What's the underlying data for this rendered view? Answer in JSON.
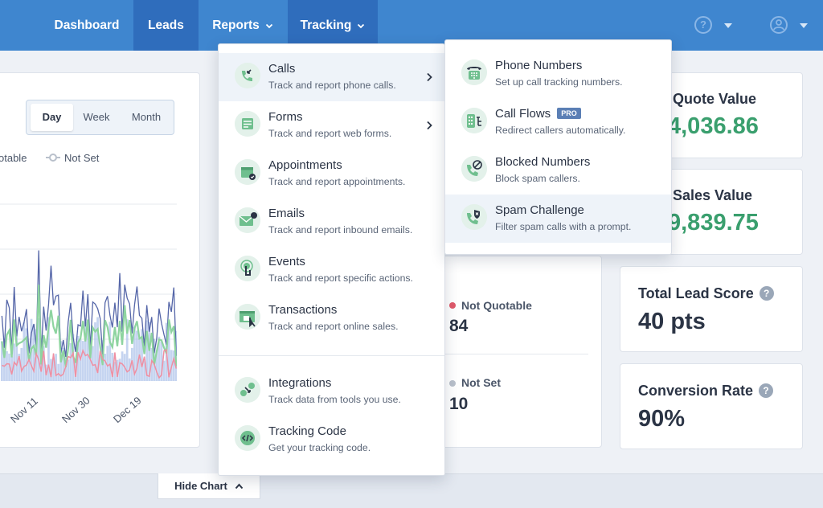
{
  "nav": {
    "items": [
      {
        "label": "Dashboard"
      },
      {
        "label": "Leads"
      },
      {
        "label": "Reports"
      },
      {
        "label": "Tracking"
      }
    ],
    "help_icon": "question-circle-icon",
    "user_icon": "user-circle-icon"
  },
  "chart_panel": {
    "period_buttons": [
      "Day",
      "Week",
      "Month"
    ],
    "legend": [
      "otable",
      "Not Set"
    ],
    "x_ticks": [
      "Nov 11",
      "Nov 30",
      "Dec 19"
    ],
    "series_colors": {
      "navy": "#5566a8",
      "green": "#8ed4a0",
      "pink": "#ef8fa2",
      "blue": "#9fb7e6"
    }
  },
  "stats": [
    {
      "label": "Not Quotable",
      "value": "84",
      "dot_color": "#e05a6b"
    },
    {
      "label": "Not Set",
      "value": "10",
      "dot_color": "#b9c0cb"
    }
  ],
  "metrics": [
    {
      "title": "Quote Value",
      "value": "4,036.86",
      "value_color": "#3a9f6e"
    },
    {
      "title": "Sales Value",
      "value": "9,839.75",
      "value_color": "#3a9f6e"
    },
    {
      "title": "Total Lead Score",
      "value": "40 pts",
      "value_color": "#2b3445"
    },
    {
      "title": "Conversion Rate",
      "value": "90%",
      "value_color": "#2b3445"
    }
  ],
  "hide_chart": {
    "label": "Hide Chart"
  },
  "tracking_menu": {
    "items": [
      {
        "title": "Calls",
        "desc": "Track and report phone calls.",
        "icon": "phone-call-icon",
        "has_submenu": true
      },
      {
        "title": "Forms",
        "desc": "Track and report web forms.",
        "icon": "form-icon",
        "has_submenu": true
      },
      {
        "title": "Appointments",
        "desc": "Track and report appointments.",
        "icon": "calendar-icon",
        "has_submenu": false
      },
      {
        "title": "Emails",
        "desc": "Track and report inbound emails.",
        "icon": "email-icon",
        "has_submenu": false
      },
      {
        "title": "Events",
        "desc": "Track and report specific actions.",
        "icon": "tap-icon",
        "has_submenu": false
      },
      {
        "title": "Transactions",
        "desc": "Track and report online sales.",
        "icon": "shopping-icon",
        "has_submenu": false
      }
    ],
    "footer_items": [
      {
        "title": "Integrations",
        "desc": "Track data from tools you use.",
        "icon": "integrations-icon"
      },
      {
        "title": "Tracking Code",
        "desc": "Get your tracking code.",
        "icon": "code-icon"
      }
    ]
  },
  "calls_submenu": {
    "items": [
      {
        "title": "Phone Numbers",
        "desc": "Set up call tracking numbers.",
        "icon": "desk-phone-icon"
      },
      {
        "title": "Call Flows",
        "desc": "Redirect callers automatically.",
        "badge": "PRO",
        "icon": "call-flow-icon"
      },
      {
        "title": "Blocked Numbers",
        "desc": "Block spam callers.",
        "icon": "blocked-phone-icon"
      },
      {
        "title": "Spam Challenge",
        "desc": "Filter spam calls with a prompt.",
        "icon": "shield-phone-icon"
      }
    ]
  }
}
